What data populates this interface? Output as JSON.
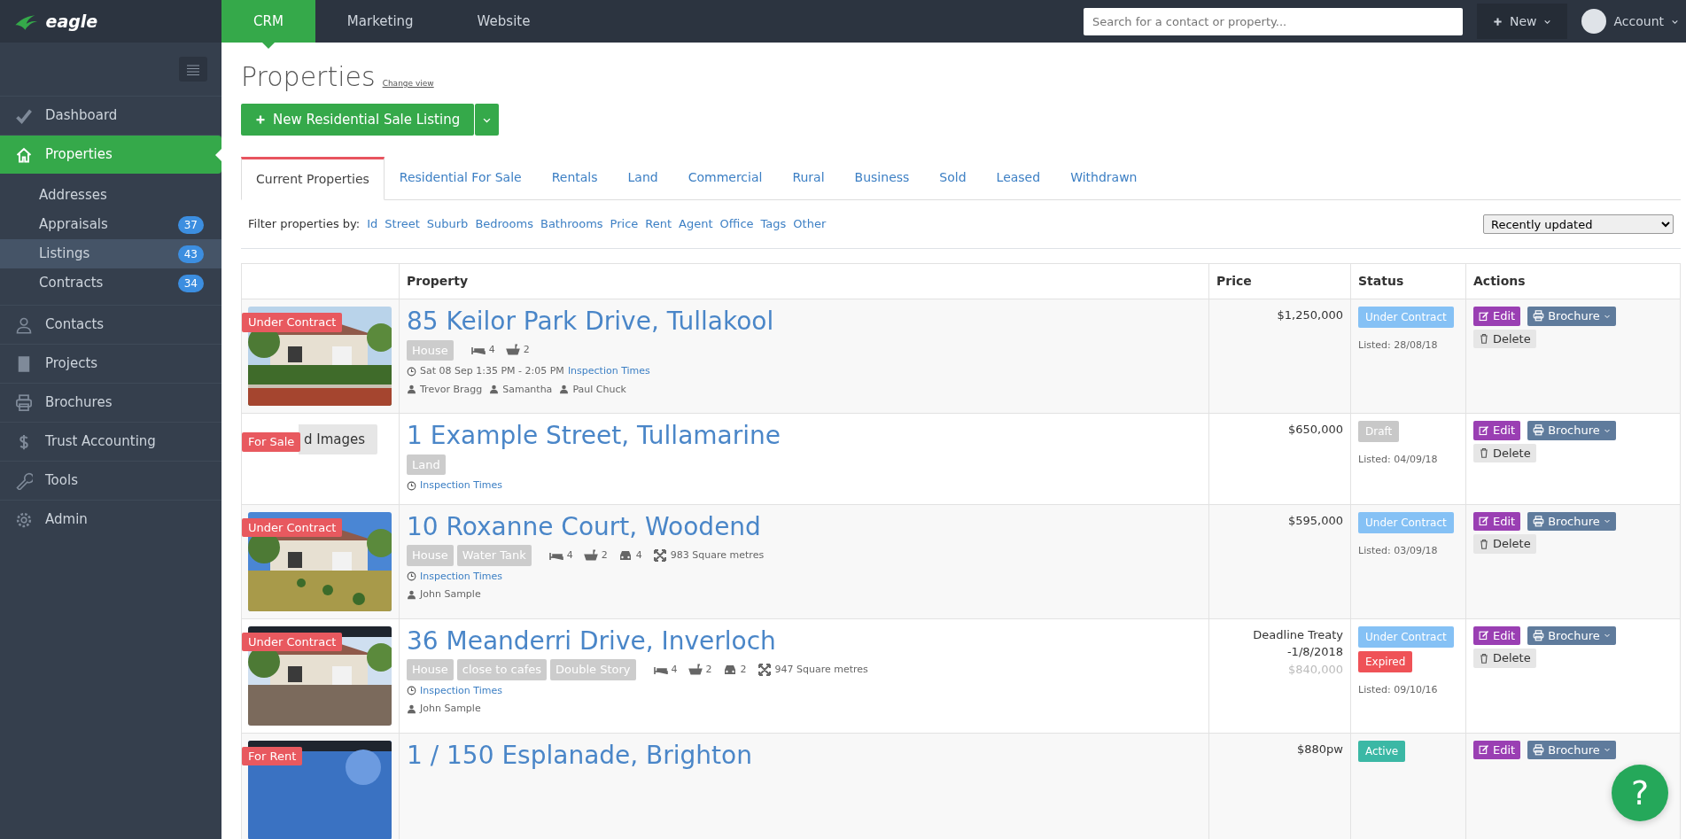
{
  "brand": {
    "name": "eagle"
  },
  "top_tabs": [
    {
      "label": "CRM",
      "selected": true
    },
    {
      "label": "Marketing",
      "selected": false
    },
    {
      "label": "Website",
      "selected": false
    }
  ],
  "search": {
    "placeholder": "Search for a contact or property..."
  },
  "new_button": {
    "label": "New"
  },
  "account": {
    "label": "Account"
  },
  "sidebar": {
    "items": [
      {
        "label": "Dashboard",
        "selected": false
      },
      {
        "label": "Properties",
        "selected": true,
        "children": [
          {
            "label": "Addresses",
            "selected": false
          },
          {
            "label": "Appraisals",
            "count": "37",
            "selected": false
          },
          {
            "label": "Listings",
            "count": "43",
            "selected": true
          },
          {
            "label": "Contracts",
            "count": "34",
            "selected": false
          }
        ]
      },
      {
        "label": "Contacts",
        "selected": false
      },
      {
        "label": "Projects",
        "selected": false
      },
      {
        "label": "Brochures",
        "selected": false
      },
      {
        "label": "Trust Accounting",
        "selected": false
      },
      {
        "label": "Tools",
        "selected": false
      },
      {
        "label": "Admin",
        "selected": false
      }
    ]
  },
  "page": {
    "title": "Properties",
    "subtitle": "Change view",
    "primary_button": "New Residential Sale Listing",
    "tabs": [
      {
        "label": "Current Properties",
        "selected": true
      },
      {
        "label": "Residential For Sale",
        "selected": false
      },
      {
        "label": "Rentals",
        "selected": false
      },
      {
        "label": "Land",
        "selected": false
      },
      {
        "label": "Commercial",
        "selected": false
      },
      {
        "label": "Rural",
        "selected": false
      },
      {
        "label": "Business",
        "selected": false
      },
      {
        "label": "Sold",
        "selected": false
      },
      {
        "label": "Leased",
        "selected": false
      },
      {
        "label": "Withdrawn",
        "selected": false
      }
    ],
    "filter_label": "Filter properties by:",
    "filters": [
      "Id",
      "Street",
      "Suburb",
      "Bedrooms",
      "Bathrooms",
      "Price",
      "Rent",
      "Agent",
      "Office",
      "Tags",
      "Other"
    ],
    "sort": {
      "value": "Recently updated"
    }
  },
  "table": {
    "columns": [
      "Property",
      "Price",
      "Status",
      "Actions"
    ],
    "rows": [
      {
        "image": {
          "kind": "picture"
        },
        "label": "Under Contract",
        "address": "85 Keilor Park Drive, Tullakool",
        "facts": [
          {
            "kind": "tag",
            "text": "House"
          },
          {
            "kind": "bed",
            "text": "4"
          },
          {
            "kind": "bath",
            "text": "2"
          }
        ],
        "inspection": [
          {
            "kind": "time",
            "text": "Sat 08 Sep 1:35 PM - 2:05 PM"
          },
          {
            "kind": "link",
            "text": "Inspection Times"
          }
        ],
        "agents": [
          "Trevor Bragg",
          "Samantha",
          "Paul Chuck"
        ],
        "price": [
          {
            "text": "$1,250,000",
            "muted": false
          }
        ],
        "statuses": [
          {
            "label": "Under Contract",
            "kind": "contract"
          }
        ],
        "listed": "Listed: 28/08/18",
        "actions": {
          "edit": "Edit",
          "brochure": "Brochure",
          "delete": "Delete"
        }
      },
      {
        "image": {
          "kind": "button",
          "text": "d Images"
        },
        "label": "For Sale",
        "address": "1 Example Street, Tullamarine",
        "facts": [
          {
            "kind": "tag",
            "text": "Land"
          }
        ],
        "inspection": [
          {
            "kind": "link",
            "text": "Inspection Times"
          }
        ],
        "agents": [],
        "price": [
          {
            "text": "$650,000",
            "muted": false
          }
        ],
        "statuses": [
          {
            "label": "Draft",
            "kind": "draft"
          }
        ],
        "listed": "Listed: 04/09/18",
        "actions": {
          "edit": "Edit",
          "brochure": "Brochure",
          "delete": "Delete"
        }
      },
      {
        "image": {
          "kind": "picture"
        },
        "label": "Under Contract",
        "address": "10 Roxanne Court, Woodend",
        "facts": [
          {
            "kind": "tag",
            "text": "House"
          },
          {
            "kind": "tag",
            "text": "Water Tank"
          },
          {
            "kind": "bed",
            "text": "4"
          },
          {
            "kind": "bath",
            "text": "2"
          },
          {
            "kind": "car",
            "text": "4"
          },
          {
            "kind": "area",
            "text": "983 Square metres"
          }
        ],
        "inspection": [
          {
            "kind": "link",
            "text": "Inspection Times"
          }
        ],
        "agents": [
          "John Sample"
        ],
        "price": [
          {
            "text": "$595,000",
            "muted": false
          }
        ],
        "statuses": [
          {
            "label": "Under Contract",
            "kind": "contract"
          }
        ],
        "listed": "Listed: 03/09/18",
        "actions": {
          "edit": "Edit",
          "brochure": "Brochure",
          "delete": "Delete"
        }
      },
      {
        "image": {
          "kind": "picture"
        },
        "label": "Under Contract",
        "address": "36 Meanderri Drive, Inverloch",
        "facts": [
          {
            "kind": "tag",
            "text": "House"
          },
          {
            "kind": "tag",
            "text": "close to cafes"
          },
          {
            "kind": "tag",
            "text": "Double Story"
          },
          {
            "kind": "bed",
            "text": "4"
          },
          {
            "kind": "bath",
            "text": "2"
          },
          {
            "kind": "car",
            "text": "2"
          },
          {
            "kind": "area",
            "text": "947 Square metres"
          }
        ],
        "inspection": [
          {
            "kind": "link",
            "text": "Inspection Times"
          }
        ],
        "agents": [
          "John Sample"
        ],
        "price": [
          {
            "text": "Deadline Treaty -1/8/2018",
            "muted": false
          },
          {
            "text": "$840,000",
            "muted": true
          }
        ],
        "statuses": [
          {
            "label": "Under Contract",
            "kind": "contract"
          },
          {
            "label": "Expired",
            "kind": "expired"
          }
        ],
        "listed": "Listed: 09/10/16",
        "actions": {
          "edit": "Edit",
          "brochure": "Brochure",
          "delete": "Delete"
        }
      },
      {
        "image": {
          "kind": "picture"
        },
        "label": "For Rent",
        "address": "1 / 150 Esplanade, Brighton",
        "facts": [],
        "inspection": [],
        "agents": [],
        "price": [
          {
            "text": "$880pw",
            "muted": false
          }
        ],
        "statuses": [
          {
            "label": "Active",
            "kind": "active"
          }
        ],
        "actions": {
          "edit": "Edit",
          "brochure": "Brochure"
        }
      }
    ]
  },
  "help_button": {
    "label": "?"
  }
}
